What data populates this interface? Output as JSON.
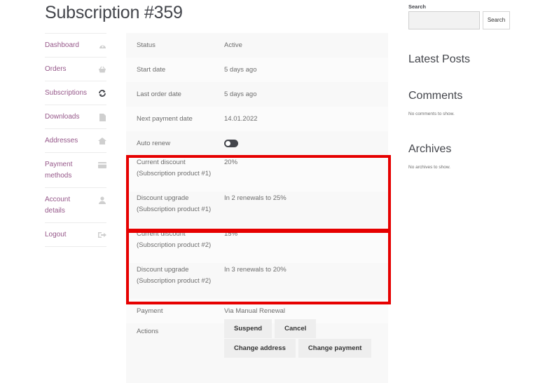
{
  "page": {
    "title": "Subscription #359"
  },
  "nav": {
    "items": [
      {
        "label": "Dashboard",
        "icon": "dashboard-icon"
      },
      {
        "label": "Orders",
        "icon": "basket-icon"
      },
      {
        "label": "Subscriptions",
        "icon": "refresh-icon",
        "active": true
      },
      {
        "label": "Downloads",
        "icon": "file-icon"
      },
      {
        "label": "Addresses",
        "icon": "home-icon"
      },
      {
        "label": "Payment methods",
        "icon": "credit-card-icon"
      },
      {
        "label": "Account details",
        "icon": "user-icon"
      },
      {
        "label": "Logout",
        "icon": "sign-out-icon"
      }
    ]
  },
  "details": {
    "status": {
      "label": "Status",
      "value": "Active"
    },
    "start_date": {
      "label": "Start date",
      "value": "5 days ago"
    },
    "last_order_date": {
      "label": "Last order date",
      "value": "5 days ago"
    },
    "next_payment_date": {
      "label": "Next payment date",
      "value": "14.01.2022"
    },
    "auto_renew": {
      "label": "Auto renew",
      "enabled": true
    },
    "current_discount_1": {
      "label": "Current discount",
      "sublabel": "(Subscription product #1)",
      "value": "20%"
    },
    "discount_upgrade_1": {
      "label": "Discount upgrade",
      "sublabel": "(Subscription product #1)",
      "value": "In 2 renewals to 25%"
    },
    "current_discount_2": {
      "label": "Current discount",
      "sublabel": "(Subscription product #2)",
      "value": "15%"
    },
    "discount_upgrade_2": {
      "label": "Discount upgrade",
      "sublabel": "(Subscription product #2)",
      "value": "In 3 renewals to 20%"
    },
    "payment": {
      "label": "Payment",
      "value": "Via Manual Renewal"
    },
    "actions": {
      "label": "Actions",
      "suspend": "Suspend",
      "cancel": "Cancel",
      "change_address": "Change address",
      "change_payment": "Change payment"
    }
  },
  "sidebar": {
    "search_label": "Search",
    "search_value": "",
    "search_button": "Search",
    "latest_posts_title": "Latest Posts",
    "comments_title": "Comments",
    "comments_text": "No comments to show.",
    "archives_title": "Archives",
    "archives_text": "No archives to show."
  },
  "colors": {
    "link": "#96588a",
    "highlight": "#e60000",
    "text": "#6d6d6d",
    "heading": "#43454b"
  }
}
